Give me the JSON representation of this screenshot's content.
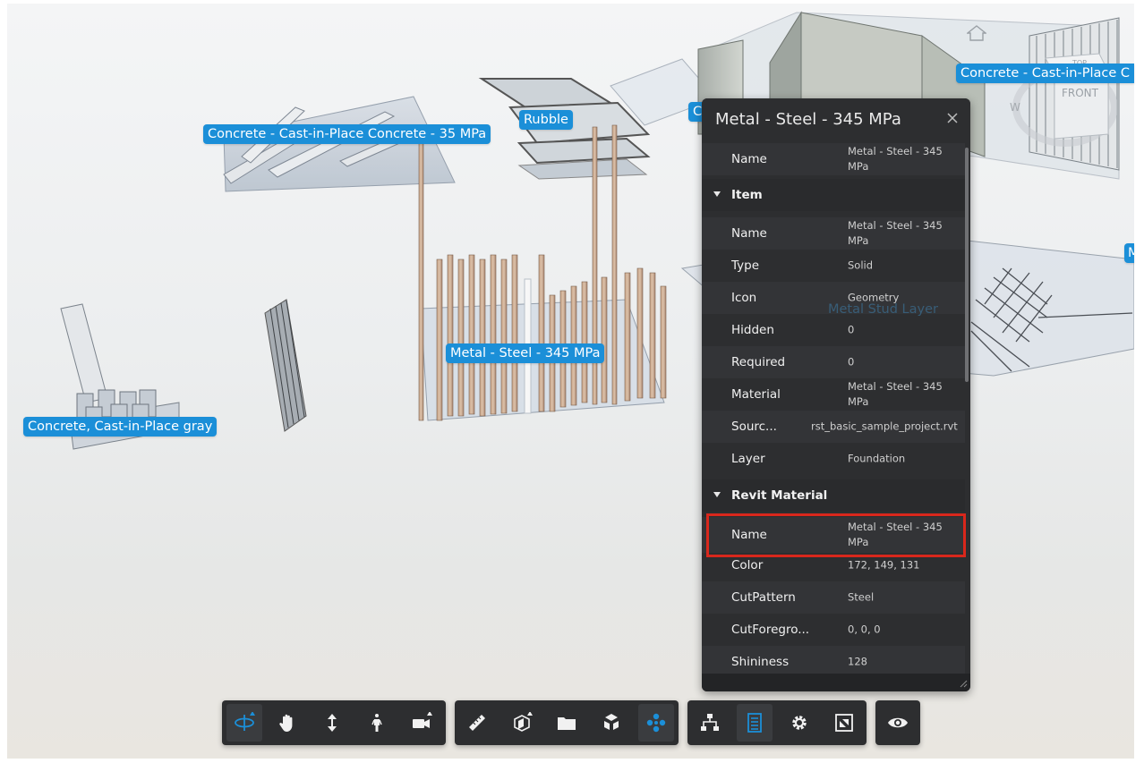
{
  "scene": {
    "labels": [
      "Concrete - Cast-in-Place Concrete - 35 MPa",
      "Rubble",
      "Concrete - Cast-in-Place C",
      "C",
      "Metal - Steel - 345 MPa",
      "Concrete, Cast-in-Place gray",
      "M",
      "Metal Stud Layer"
    ],
    "nav_cube": {
      "top_face": "TOP",
      "front_face": "FRONT",
      "compass_mark": "W"
    }
  },
  "properties_panel": {
    "title": "Metal - Steel - 345 MPa",
    "top_row": {
      "label": "Name",
      "value": "Metal - Steel - 345 MPa"
    },
    "categories": [
      {
        "name": "Item",
        "rows": [
          {
            "label": "Name",
            "value": "Metal - Steel - 345 MPa"
          },
          {
            "label": "Type",
            "value": "Solid"
          },
          {
            "label": "Icon",
            "value": "Geometry"
          },
          {
            "label": "Hidden",
            "value": "0"
          },
          {
            "label": "Required",
            "value": "0"
          },
          {
            "label": "Material",
            "value": "Metal - Steel - 345 MPa"
          },
          {
            "label": "Sourc...",
            "value": "rst_basic_sample_project.rvt"
          },
          {
            "label": "Layer",
            "value": "Foundation"
          }
        ]
      },
      {
        "name": "Revit Material",
        "rows": [
          {
            "label": "Name",
            "value": "Metal - Steel - 345 MPa"
          },
          {
            "label": "Color",
            "value": "172, 149, 131"
          },
          {
            "label": "CutPattern",
            "value": "Steel"
          },
          {
            "label": "CutForegro...",
            "value": "0, 0, 0"
          },
          {
            "label": "Shininess",
            "value": "128"
          }
        ]
      }
    ]
  },
  "toolbar": {
    "navigation": [
      "orbit-icon",
      "pan-icon",
      "zoom-icon",
      "walk-icon",
      "camera-icon"
    ],
    "tools": [
      "measure-icon",
      "section-icon",
      "folder-icon",
      "explode-icon",
      "materials-icon"
    ],
    "panels": [
      "model-tree-icon",
      "properties-icon",
      "settings-icon",
      "fullscreen-icon"
    ],
    "view": [
      "visibility-icon"
    ],
    "active_color": "#1b8fd8"
  },
  "colors": {
    "label_bg": "#1b8fd8",
    "panel_bg": "#2d2e30",
    "highlight": "#d9271c"
  }
}
